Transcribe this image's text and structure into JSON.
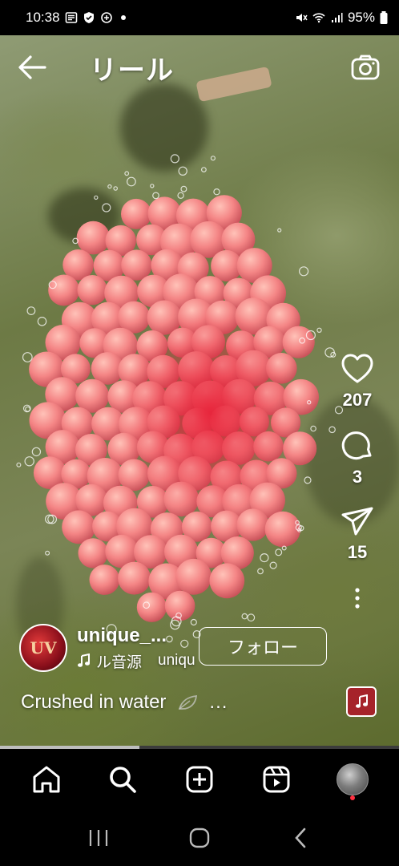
{
  "status": {
    "time": "10:38",
    "battery": "95%"
  },
  "header": {
    "title": "リール"
  },
  "actions": {
    "like_count": "207",
    "comment_count": "3",
    "share_count": "15"
  },
  "author": {
    "username": "unique_...",
    "avatar_text": "UV",
    "audio_label": "ル音源",
    "audio_user": "uniqu",
    "follow_label": "フォロー"
  },
  "caption": {
    "text": "Crushed in water",
    "more": "..."
  },
  "progress": {
    "fraction": 0.35
  },
  "colors": {
    "egg_pink": "#f48585",
    "egg_highlight": "#ffc2b8",
    "egg_core": "#e8233a",
    "notification": "#ff3040"
  }
}
